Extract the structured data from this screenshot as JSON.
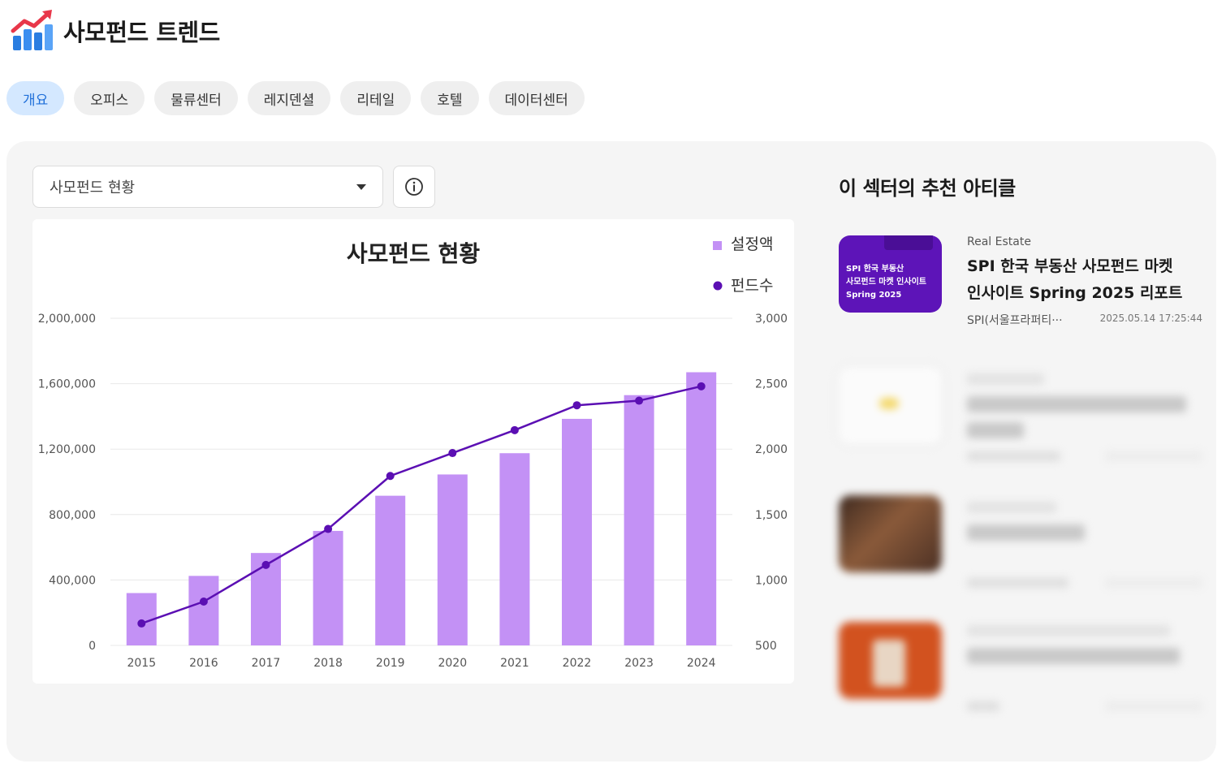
{
  "app": {
    "title": "사모펀드 트렌드"
  },
  "tabs": [
    {
      "label": "개요",
      "active": true
    },
    {
      "label": "오피스",
      "active": false
    },
    {
      "label": "물류센터",
      "active": false
    },
    {
      "label": "레지덴셜",
      "active": false
    },
    {
      "label": "리테일",
      "active": false
    },
    {
      "label": "호텔",
      "active": false
    },
    {
      "label": "데이터센터",
      "active": false
    }
  ],
  "controls": {
    "dataset_select": {
      "value": "사모펀드 현황"
    },
    "info_icon": "info-circle-icon"
  },
  "chart_data": {
    "type": "bar+line",
    "title": "사모펀드 현황",
    "categories": [
      "2015",
      "2016",
      "2017",
      "2018",
      "2019",
      "2020",
      "2021",
      "2022",
      "2023",
      "2024"
    ],
    "series": [
      {
        "name": "설정액",
        "type": "bar",
        "axis": "left",
        "color": "#c391f5",
        "values": [
          320000,
          425000,
          565000,
          700000,
          915000,
          1045000,
          1175000,
          1385000,
          1530000,
          1670000
        ]
      },
      {
        "name": "펀드수",
        "type": "line",
        "axis": "right",
        "color": "#5b0fb3",
        "values": [
          668,
          835,
          1115,
          1390,
          1795,
          1970,
          2145,
          2335,
          2370,
          2480
        ]
      }
    ],
    "y_left": {
      "ticks": [
        "2,000,000",
        "1,600,000",
        "1,200,000",
        "800,000",
        "400,000",
        "0"
      ],
      "range": [
        0,
        2000000
      ]
    },
    "y_right": {
      "ticks": [
        "3,000",
        "2,500",
        "2,000",
        "1,500",
        "1,000",
        "500"
      ],
      "range": [
        500,
        3000
      ]
    },
    "grid": true,
    "legend_position": "top-right"
  },
  "sidebar": {
    "title": "이 섹터의 추천 아티클",
    "articles": [
      {
        "category": "Real Estate",
        "title_line1": "SPI 한국 부동산 사모펀드 마켓",
        "title_line2": "인사이트 Spring 2025 리포트",
        "author": "SPI(서울프라퍼티···",
        "date": "2025.05.14 17:25:44",
        "thumb_lines": [
          "SPI 한국 부동산",
          "사모펀드 마켓 인사이트",
          "Spring 2025"
        ],
        "thumb_color": "#5d14b8"
      },
      {
        "category": "",
        "title_line1": "",
        "title_line2": "",
        "author": "",
        "date": "",
        "thumb_color": "#fbfbfb",
        "blurred": true
      },
      {
        "category": "",
        "title_line1": "",
        "title_line2": "",
        "author": "",
        "date": "",
        "thumb_color": "#6b4a3a",
        "blurred": true
      },
      {
        "category": "",
        "title_line1": "",
        "title_line2": "",
        "author": "",
        "date": "",
        "thumb_color": "#d2521f",
        "blurred": true
      }
    ]
  }
}
